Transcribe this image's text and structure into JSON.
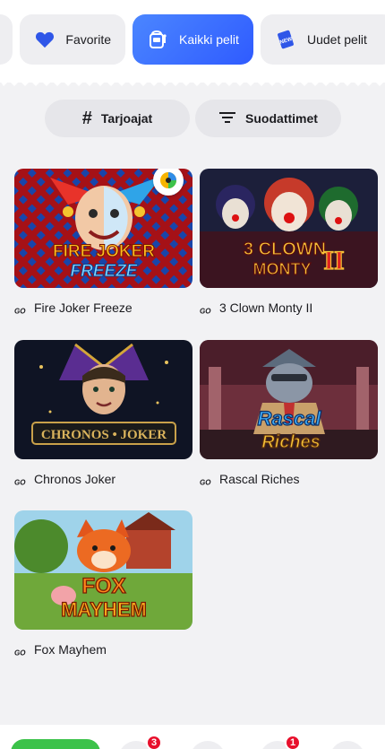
{
  "categories": [
    {
      "label": "",
      "icon": "partial-tab"
    },
    {
      "label": "Favorite",
      "icon": "heart-icon"
    },
    {
      "label": "Kaikki pelit",
      "icon": "slot-machine-icon",
      "active": true
    },
    {
      "label": "Uudet pelit",
      "icon": "new-card-icon"
    }
  ],
  "filters": {
    "providers_label": "Tarjoajat",
    "filters_label": "Suodattimet"
  },
  "games": [
    {
      "title": "Fire Joker Freeze",
      "art_text_1": "FIRE JOKER",
      "art_text_2": "FREEZE"
    },
    {
      "title": "3 Clown Monty II",
      "art_text_1": "3 CLOWN",
      "art_text_2": "MONTY",
      "art_text_3": "II"
    },
    {
      "title": "Chronos Joker",
      "art_text_1": "CHRONOS • JOKER"
    },
    {
      "title": "Rascal Riches",
      "art_text_1": "Rascal",
      "art_text_2": "Riches"
    },
    {
      "title": "Fox Mayhem",
      "art_text_1": "FOX",
      "art_text_2": "MAYHEM"
    }
  ],
  "bottom_nav": {
    "badge_1": "3",
    "badge_2": "1"
  },
  "colors": {
    "accent": "#3a6bff",
    "green": "#3cc24a",
    "badge": "#e8102c"
  }
}
